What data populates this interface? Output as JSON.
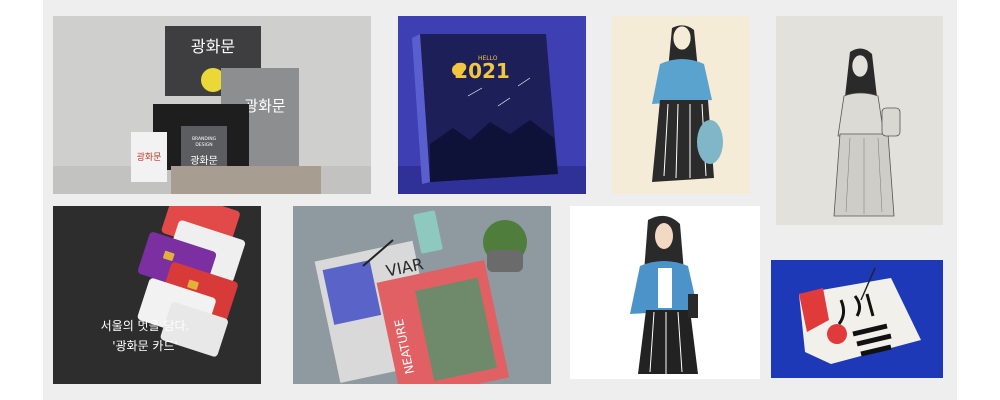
{
  "gallery": {
    "tiles": [
      {
        "name": "gwanghwamun-branding",
        "texts": {
          "envelope": "광화문",
          "card_main": "광화문",
          "logo": "광화문",
          "small_card": "광화문",
          "studio_line1": "BRANDING",
          "studio_line2": "DESIGN",
          "studio_line3": "GRAPHIC DESIGN",
          "studio_line4": "SOK KOD 2016"
        }
      },
      {
        "name": "hello-2021-book",
        "texts": {
          "hello": "HELLO",
          "year": "2021"
        }
      },
      {
        "name": "illustration-woman-blue-shirt",
        "texts": {}
      },
      {
        "name": "illustration-woman-sketch",
        "texts": {}
      },
      {
        "name": "gwanghwamun-card",
        "texts": {
          "line1": "서울의 멋을 담다.",
          "line2": "'광화문 카드'"
        }
      },
      {
        "name": "magazine-mockup",
        "texts": {
          "mag1": "VIAR",
          "mag2": "NEATURE"
        }
      },
      {
        "name": "illustration-woman-denim",
        "texts": {}
      },
      {
        "name": "calligraphy-flag",
        "texts": {}
      }
    ]
  },
  "colors": {
    "canvas": "#eeeeee",
    "charcoal": "#333333",
    "navy": "#2b2f73",
    "cobalt": "#1f3fbf",
    "coral": "#e0565b"
  }
}
